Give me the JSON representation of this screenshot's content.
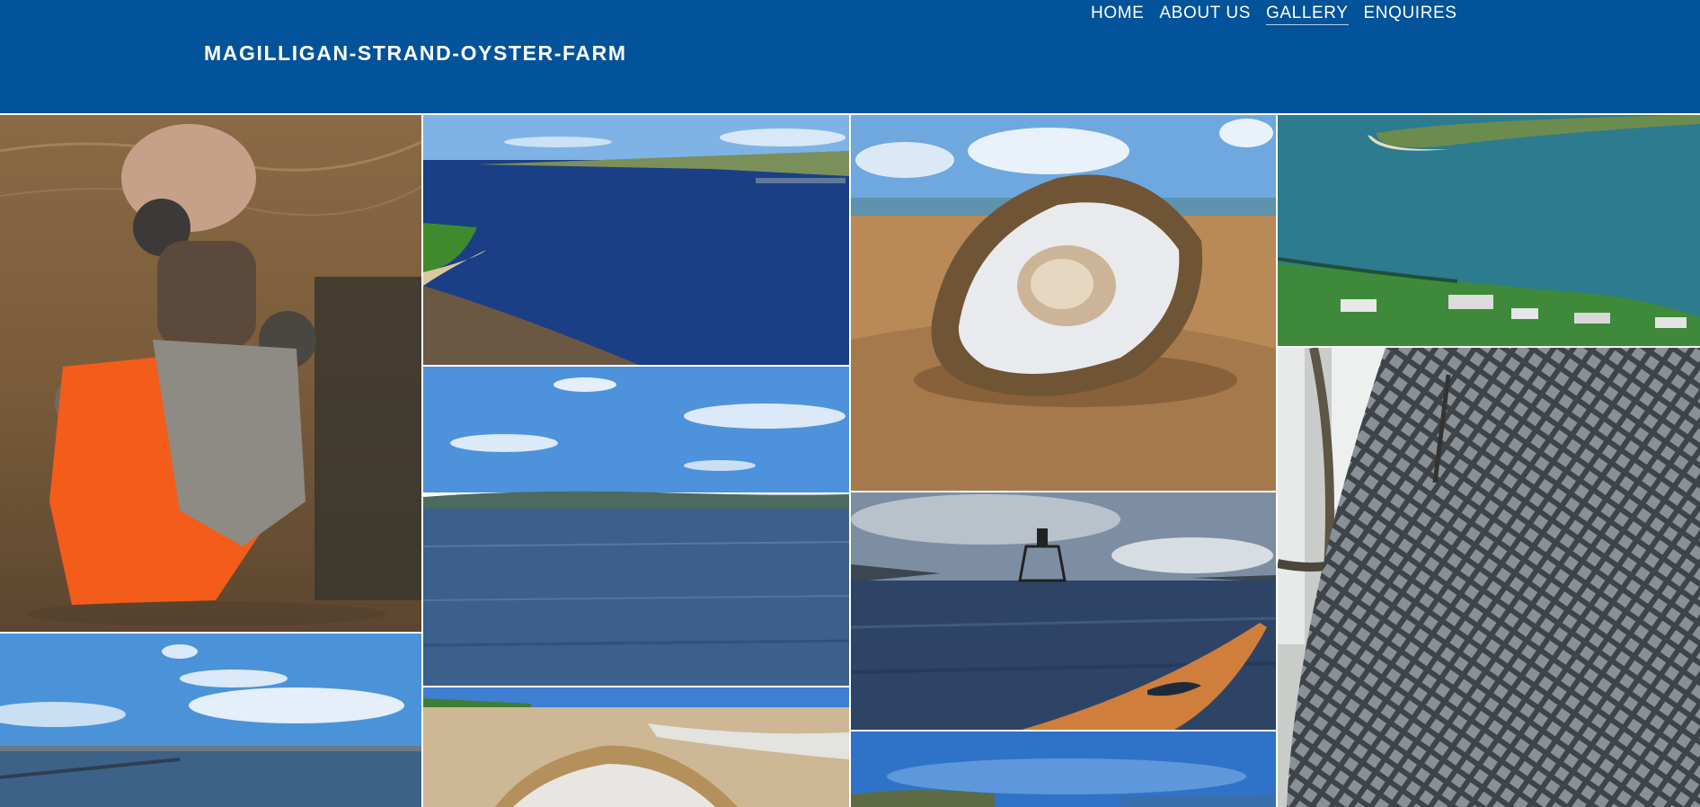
{
  "site": {
    "title": "MAGILLIGAN-STRAND-OYSTER-FARM"
  },
  "nav": {
    "items": [
      {
        "label": "HOME",
        "active": false
      },
      {
        "label": "ABOUT US",
        "active": false
      },
      {
        "label": "GALLERY",
        "active": true
      },
      {
        "label": "ENQUIRES",
        "active": false
      }
    ]
  },
  "colors": {
    "header_bg": "#03539a",
    "text": "#ffffff"
  },
  "gallery": {
    "photos": [
      {
        "id": "farmers-wading"
      },
      {
        "id": "aerial-lough"
      },
      {
        "id": "oyster-on-sand"
      },
      {
        "id": "aerial-coast-village"
      },
      {
        "id": "calm-sea-sky"
      },
      {
        "id": "lighthouse-kayak"
      },
      {
        "id": "oyster-net-bag"
      },
      {
        "id": "sea-horizon-clouds"
      },
      {
        "id": "beach-oyster"
      },
      {
        "id": "coast-blue-sky"
      }
    ]
  }
}
